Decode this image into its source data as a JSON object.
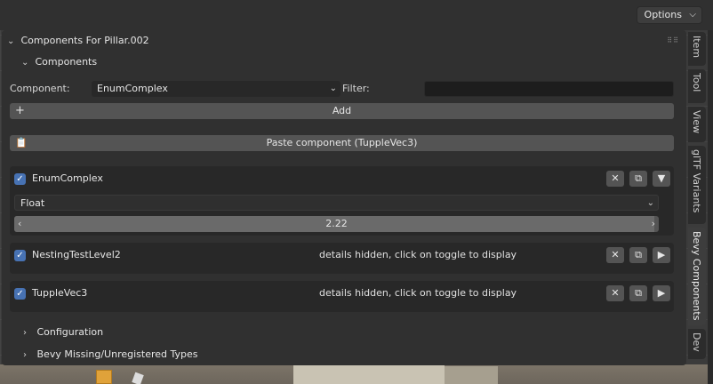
{
  "header": {
    "options_label": "Options",
    "options_chevron": "⌵"
  },
  "panel": {
    "title": "Components For Pillar.002",
    "subsection": "Components",
    "component_label": "Component:",
    "component_value": "EnumComplex",
    "filter_label": "Filter:",
    "filter_value": "",
    "add_label": "Add",
    "paste_label": "Paste component (TuppleVec3)"
  },
  "components": [
    {
      "name": "EnumComplex",
      "enabled": true,
      "expanded": true,
      "variant": "Float",
      "value": "2.22"
    },
    {
      "name": "NestingTestLevel2",
      "enabled": true,
      "expanded": false,
      "hint": "details hidden, click on toggle to display"
    },
    {
      "name": "TuppleVec3",
      "enabled": true,
      "expanded": false,
      "hint": "details hidden, click on toggle to display"
    }
  ],
  "collapsed_sections": [
    {
      "label": "Configuration"
    },
    {
      "label": "Bevy Missing/Unregistered Types"
    }
  ],
  "side_tabs": [
    {
      "label": "Item"
    },
    {
      "label": "Tool"
    },
    {
      "label": "View"
    },
    {
      "label": "glTF Variants"
    },
    {
      "label": "Bevy Components"
    },
    {
      "label": "Dev"
    }
  ],
  "icons": {
    "remove": "close-icon",
    "copy": "copy-icon",
    "toggle_open": "triangle-down-icon",
    "toggle_closed": "triangle-right-icon",
    "add": "plus-icon",
    "paste": "clipboard-icon"
  },
  "colors": {
    "checkbox_accent": "#4772b3",
    "panel_bg": "#303030",
    "button_bg": "#545454"
  }
}
